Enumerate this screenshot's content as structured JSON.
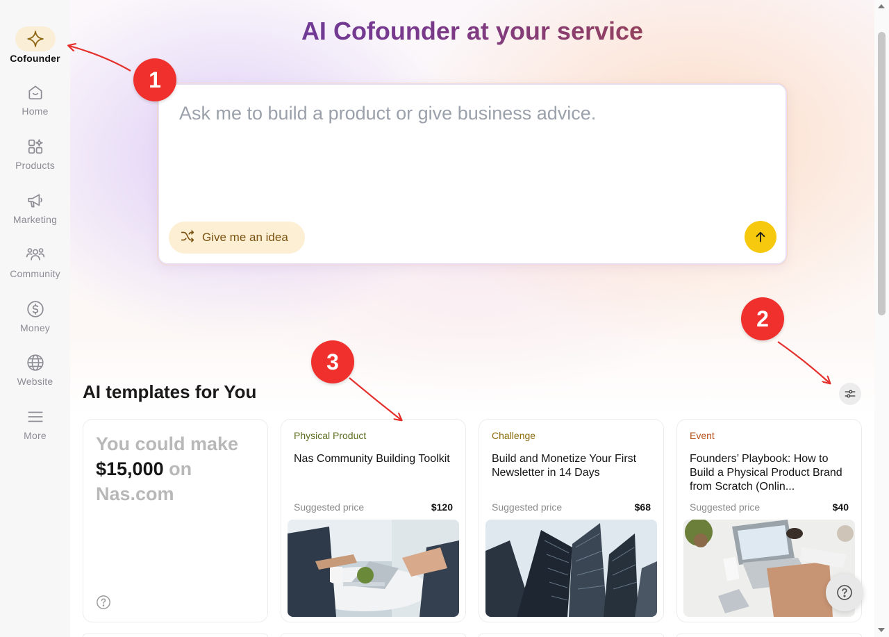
{
  "sidebar": {
    "items": [
      {
        "label": "Cofounder",
        "icon": "sparkle-icon",
        "active": true
      },
      {
        "label": "Home",
        "icon": "home-icon"
      },
      {
        "label": "Products",
        "icon": "products-icon"
      },
      {
        "label": "Marketing",
        "icon": "megaphone-icon"
      },
      {
        "label": "Community",
        "icon": "people-icon"
      },
      {
        "label": "Money",
        "icon": "dollar-icon"
      },
      {
        "label": "Website",
        "icon": "globe-icon"
      },
      {
        "label": "More",
        "icon": "menu-icon"
      }
    ]
  },
  "hero": {
    "title": "AI Cofounder at your service",
    "prompt_placeholder": "Ask me to build a product or give business advice.",
    "idea_button": "Give me an idea"
  },
  "templates": {
    "section_title": "AI templates for You",
    "earn_card": {
      "line1": "You could make",
      "amount": "$15,000",
      "on": "on",
      "site": "Nas.com"
    },
    "cards": [
      {
        "category": "Physical Product",
        "category_color": "#5b6e1f",
        "title": "Nas Community Building Toolkit",
        "price_label": "Suggested price",
        "price": "$120",
        "image": "office-meeting"
      },
      {
        "category": "Challenge",
        "category_color": "#8a6a0a",
        "title": "Build and Monetize Your First Newsletter in 14 Days",
        "price_label": "Suggested price",
        "price": "$68",
        "image": "skyscrapers"
      },
      {
        "category": "Event",
        "category_color": "#b5521a",
        "title": "Founders’ Playbook: How to Build a Physical Product Brand from Scratch (Onlin...",
        "price_label": "Suggested price",
        "price": "$40",
        "image": "desk-laptop"
      }
    ]
  },
  "annotations": [
    "1",
    "2",
    "3"
  ],
  "colors": {
    "accent": "#f6c80e",
    "badge": "#f0302c",
    "active_nav_bg": "#fbeed6"
  }
}
